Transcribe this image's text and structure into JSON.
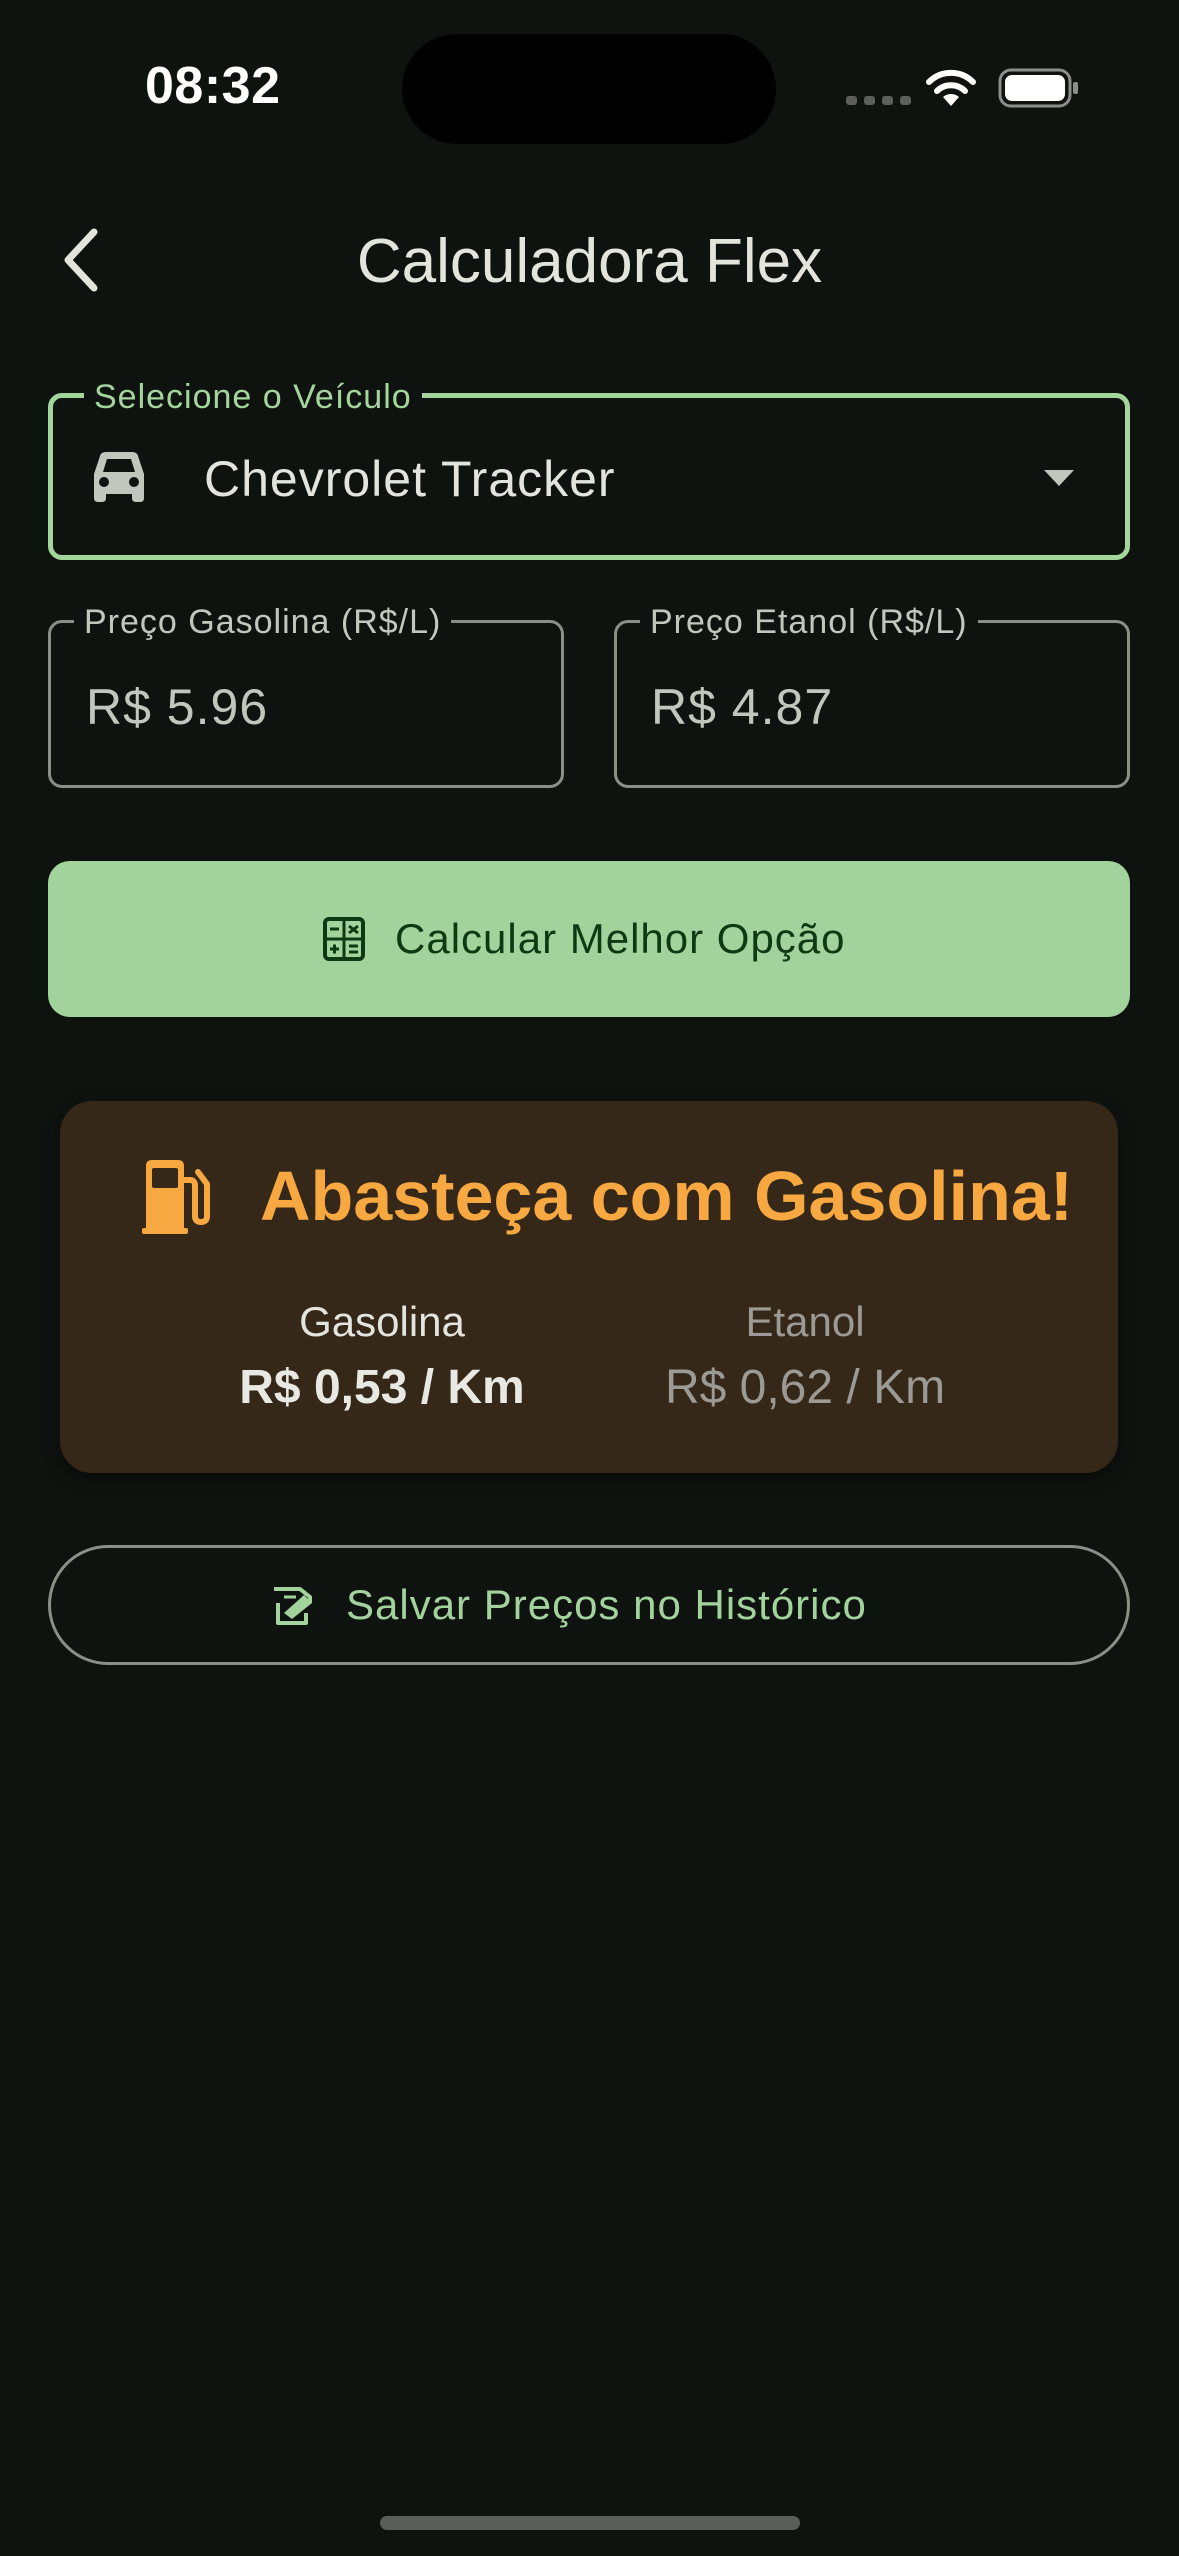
{
  "status_bar": {
    "time": "08:32"
  },
  "header": {
    "title": "Calculadora Flex"
  },
  "vehicle": {
    "label": "Selecione o Veículo",
    "selected": "Chevrolet Tracker"
  },
  "gasoline": {
    "label": "Preço Gasolina (R$/L)",
    "value": "R$ 5.96"
  },
  "ethanol": {
    "label": "Preço Etanol (R$/L)",
    "value": "R$ 4.87"
  },
  "calculate": {
    "label": "Calcular Melhor Opção"
  },
  "result": {
    "title": "Abasteça com Gasolina!",
    "gasoline_label": "Gasolina",
    "gasoline_value": "R$ 0,53 / Km",
    "ethanol_label": "Etanol",
    "ethanol_value": "R$ 0,62 / Km"
  },
  "save": {
    "label": "Salvar Preços no Histórico"
  },
  "colors": {
    "background": "#0f130f",
    "accent_green": "#a3d39c",
    "result_orange": "#f7a840",
    "result_card": "#352818"
  },
  "icons": [
    "back-icon",
    "car-icon",
    "dropdown-icon",
    "calculator-icon",
    "fuel-pump-icon",
    "save-receipt-icon",
    "wifi-icon",
    "battery-icon"
  ]
}
